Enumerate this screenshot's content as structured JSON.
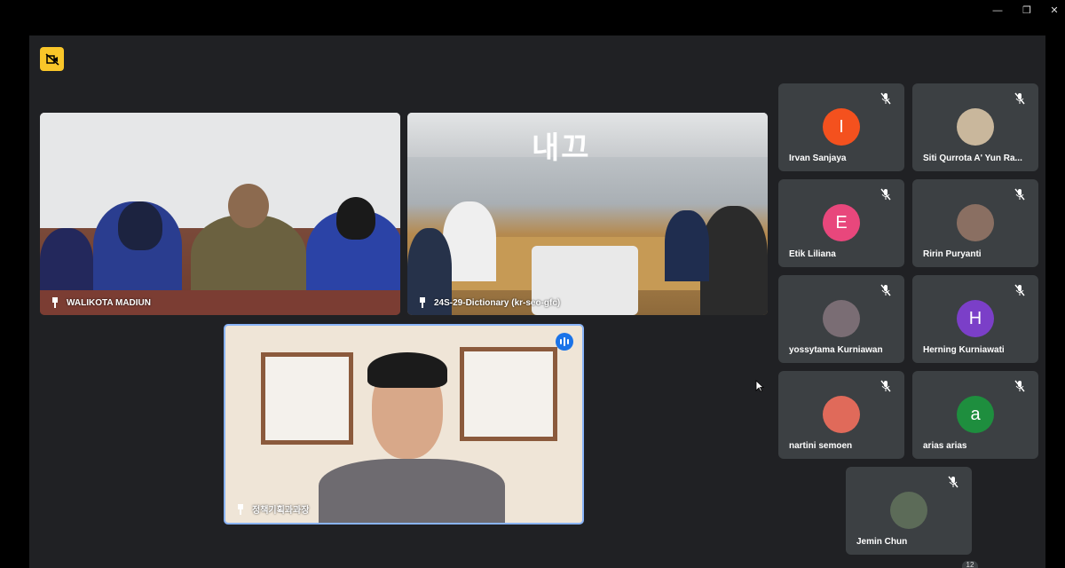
{
  "tiles": {
    "main1": {
      "name": "WALIKOTA MADIUN"
    },
    "main2": {
      "name": "24S-29-Dictionary (kr-seo-gfc)",
      "sign": "내끄"
    },
    "main3": {
      "name": "정책기획과과장"
    }
  },
  "participants": [
    {
      "name": "Irvan Sanjaya",
      "avatar_letter": "I",
      "avatar_color": "#f4511e"
    },
    {
      "name": "Siti Qurrota A' Yun Ra...",
      "avatar_letter": "",
      "avatar_color": "#c9b79c"
    },
    {
      "name": "Etik Liliana",
      "avatar_letter": "E",
      "avatar_color": "#e8477c"
    },
    {
      "name": "Ririn Puryanti",
      "avatar_letter": "",
      "avatar_color": "#8a6f62"
    },
    {
      "name": "yossytama Kurniawan",
      "avatar_letter": "",
      "avatar_color": "#7a6d74"
    },
    {
      "name": "Herning Kurniawati",
      "avatar_letter": "H",
      "avatar_color": "#7b3fc8"
    },
    {
      "name": "nartini semoen",
      "avatar_letter": "",
      "avatar_color": "#e06a5a"
    },
    {
      "name": "arias arias",
      "avatar_letter": "a",
      "avatar_color": "#1e8e3e"
    },
    {
      "name": "Jemin Chun",
      "avatar_letter": "",
      "avatar_color": "#5c6b58"
    }
  ],
  "overflow_count": "12",
  "colors": {
    "camera_off": "#f9c629",
    "speaking": "#1a73e8",
    "tile_bg": "#3c4043",
    "stage_bg": "#202124"
  }
}
